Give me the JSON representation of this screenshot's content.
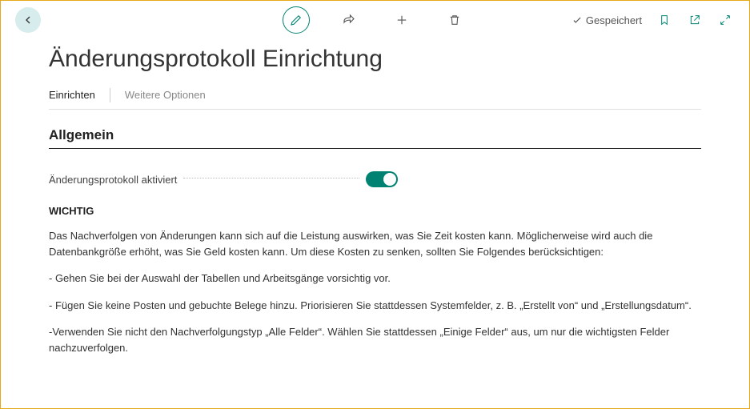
{
  "toolbar": {
    "saved_label": "Gespeichert"
  },
  "page": {
    "title": "Änderungsprotokoll Einrichtung"
  },
  "tabs": {
    "setup": "Einrichten",
    "more": "Weitere Optionen"
  },
  "section": {
    "general": "Allgemein"
  },
  "fields": {
    "activated_label": "Änderungsprotokoll aktiviert",
    "activated_on": true
  },
  "notice": {
    "heading": "WICHTIG",
    "p1": "Das Nachverfolgen von Änderungen kann sich auf die Leistung auswirken, was Sie Zeit kosten kann. Möglicherweise wird auch die Datenbankgröße erhöht, was Sie Geld kosten kann. Um diese Kosten zu senken, sollten Sie Folgendes berücksichtigen:",
    "p2": "- Gehen Sie bei der Auswahl der Tabellen und Arbeitsgänge vorsichtig vor.",
    "p3": "- Fügen Sie keine Posten und gebuchte Belege hinzu. Priorisieren Sie stattdessen Systemfelder, z. B. „Erstellt von“ und „Erstellungsdatum“.",
    "p4": "-Verwenden Sie nicht den Nachverfolgungstyp „Alle Felder“. Wählen Sie stattdessen „Einige Felder“ aus, um nur die wichtigsten Felder nachzuverfolgen."
  }
}
